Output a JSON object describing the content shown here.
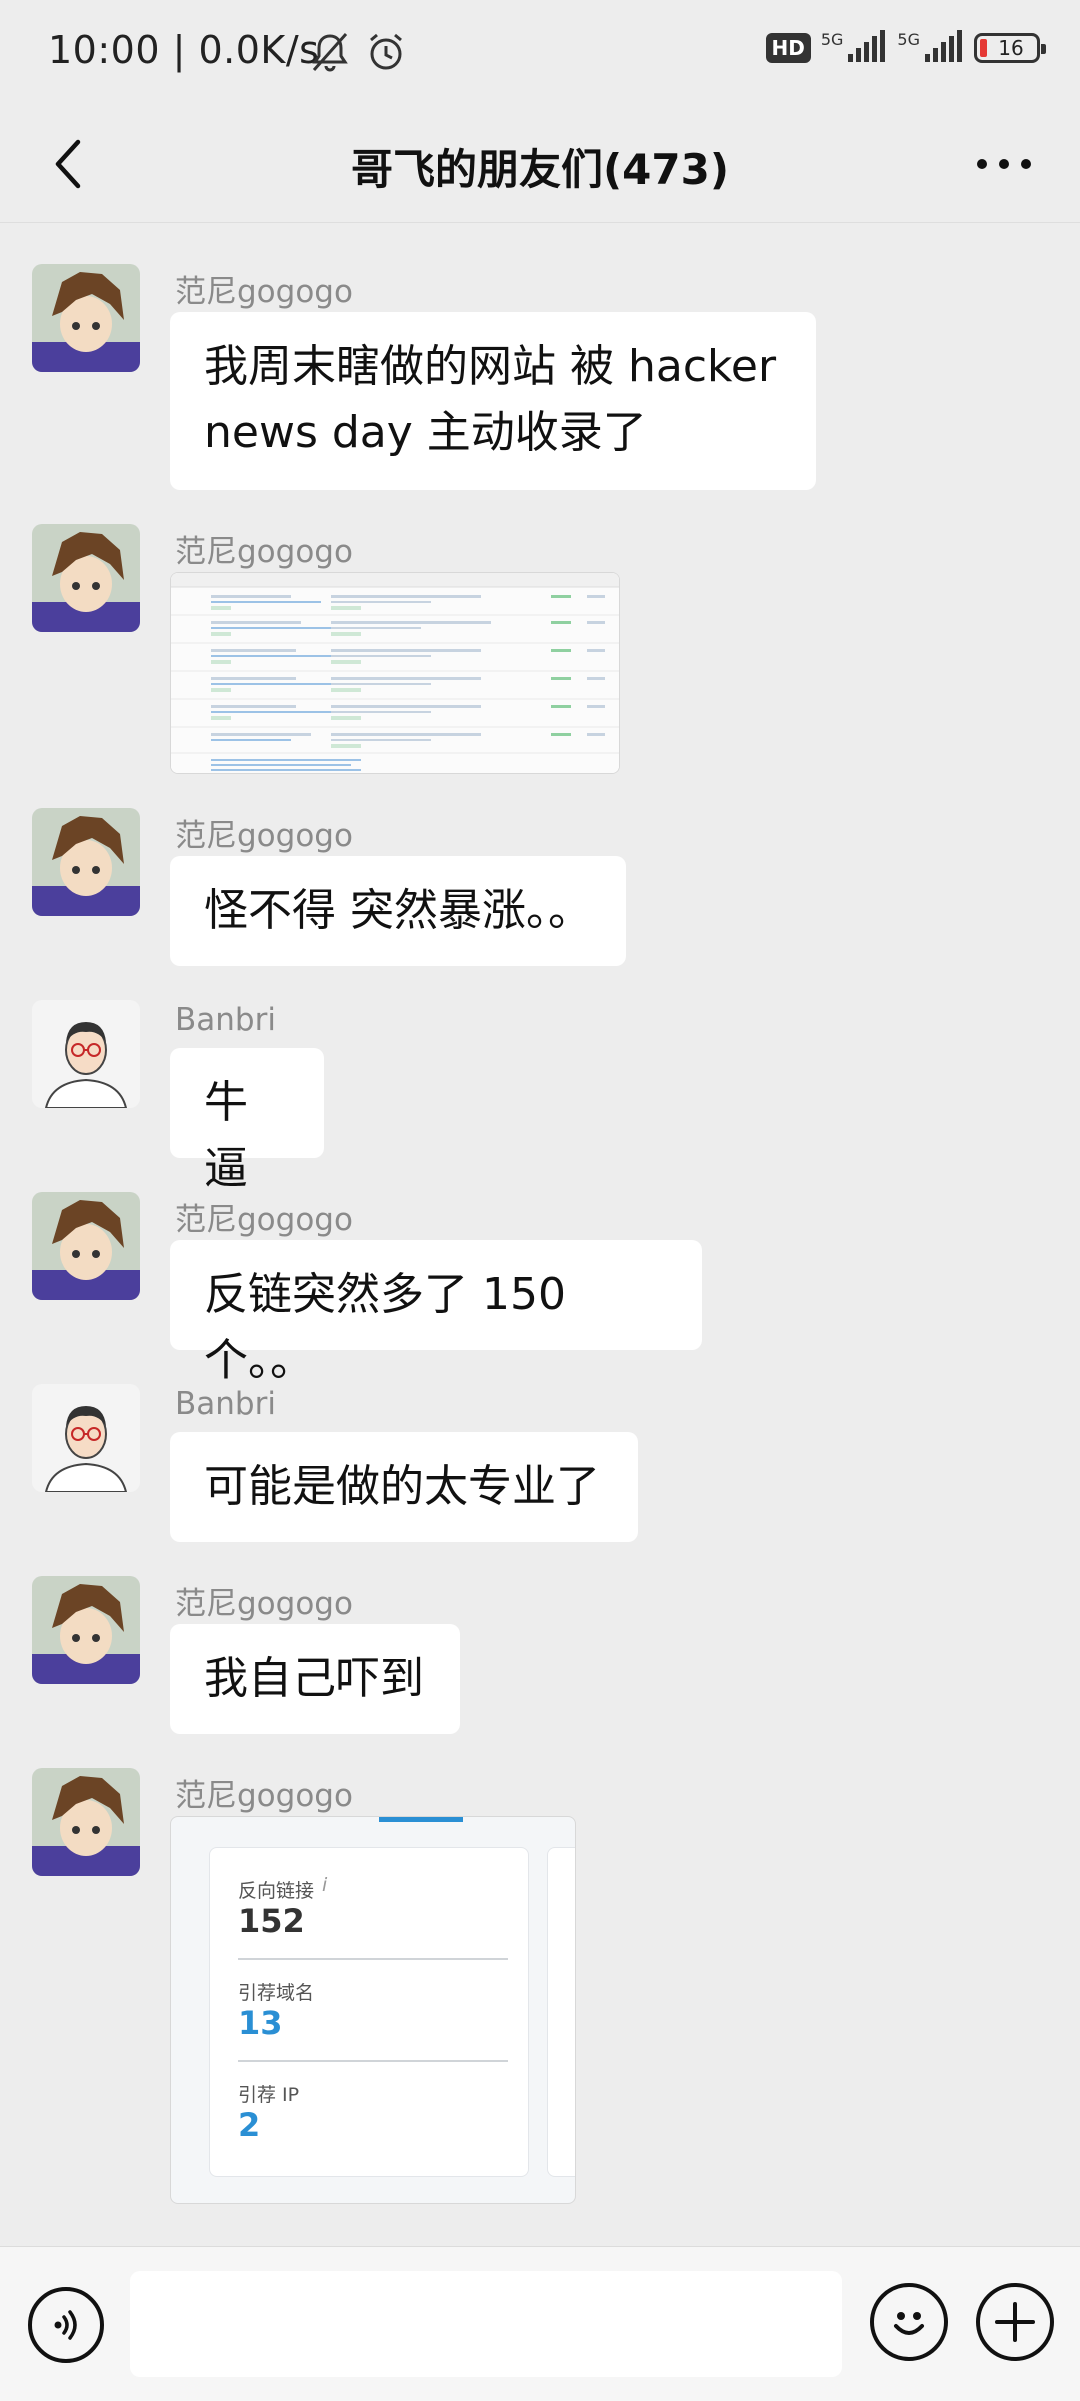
{
  "status_bar": {
    "time_speed": "10:00 | 0.0K/s",
    "hd": "HD",
    "net1": "5G",
    "net2": "5G",
    "battery": "16"
  },
  "header": {
    "title": "哥飞的朋友们(473)"
  },
  "messages": [
    {
      "sender": "范尼gogogo",
      "text_line1": "我周末瞎做的网站 被 hacker",
      "text_line2": "news day 主动收录了"
    },
    {
      "sender": "范尼gogogo"
    },
    {
      "sender": "范尼gogogo",
      "text": "怪不得 突然暴涨。。"
    },
    {
      "sender": "Banbri",
      "text": "牛逼"
    },
    {
      "sender": "范尼gogogo",
      "text": "反链突然多了 150 个。。"
    },
    {
      "sender": "Banbri",
      "text": "可能是做的太专业了"
    },
    {
      "sender": "范尼gogogo",
      "text": "我自己吓到"
    },
    {
      "sender": "范尼gogogo",
      "stats": {
        "backlinks_label": "反向链接",
        "backlinks_value": "152",
        "ref_domains_label": "引荐域名",
        "ref_domains_value": "13",
        "ref_ips_label": "引荐 IP",
        "ref_ips_value": "2"
      }
    }
  ],
  "input_bar": {
    "placeholder": ""
  },
  "colors": {
    "background": "#ededed",
    "bubble": "#ffffff",
    "link_blue": "#2a8fd4"
  }
}
